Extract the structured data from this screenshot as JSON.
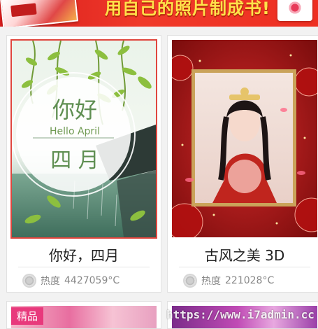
{
  "banner": {
    "text": "用自己的照片制成书!"
  },
  "cards": [
    {
      "title": "你好，四月",
      "heat_label": "热度",
      "heat_value": "4427059°C",
      "art_text_cn": "你好",
      "art_text_en": "Hello April",
      "art_text_month": "四 月",
      "selected": true
    },
    {
      "title": "古风之美 3D",
      "heat_label": "热度",
      "heat_value": "221028°C",
      "selected": false
    }
  ],
  "bottom_row": [
    {
      "tag": "精品"
    },
    {
      "tag": ""
    }
  ],
  "watermark": "https://www.i7admin.cc"
}
